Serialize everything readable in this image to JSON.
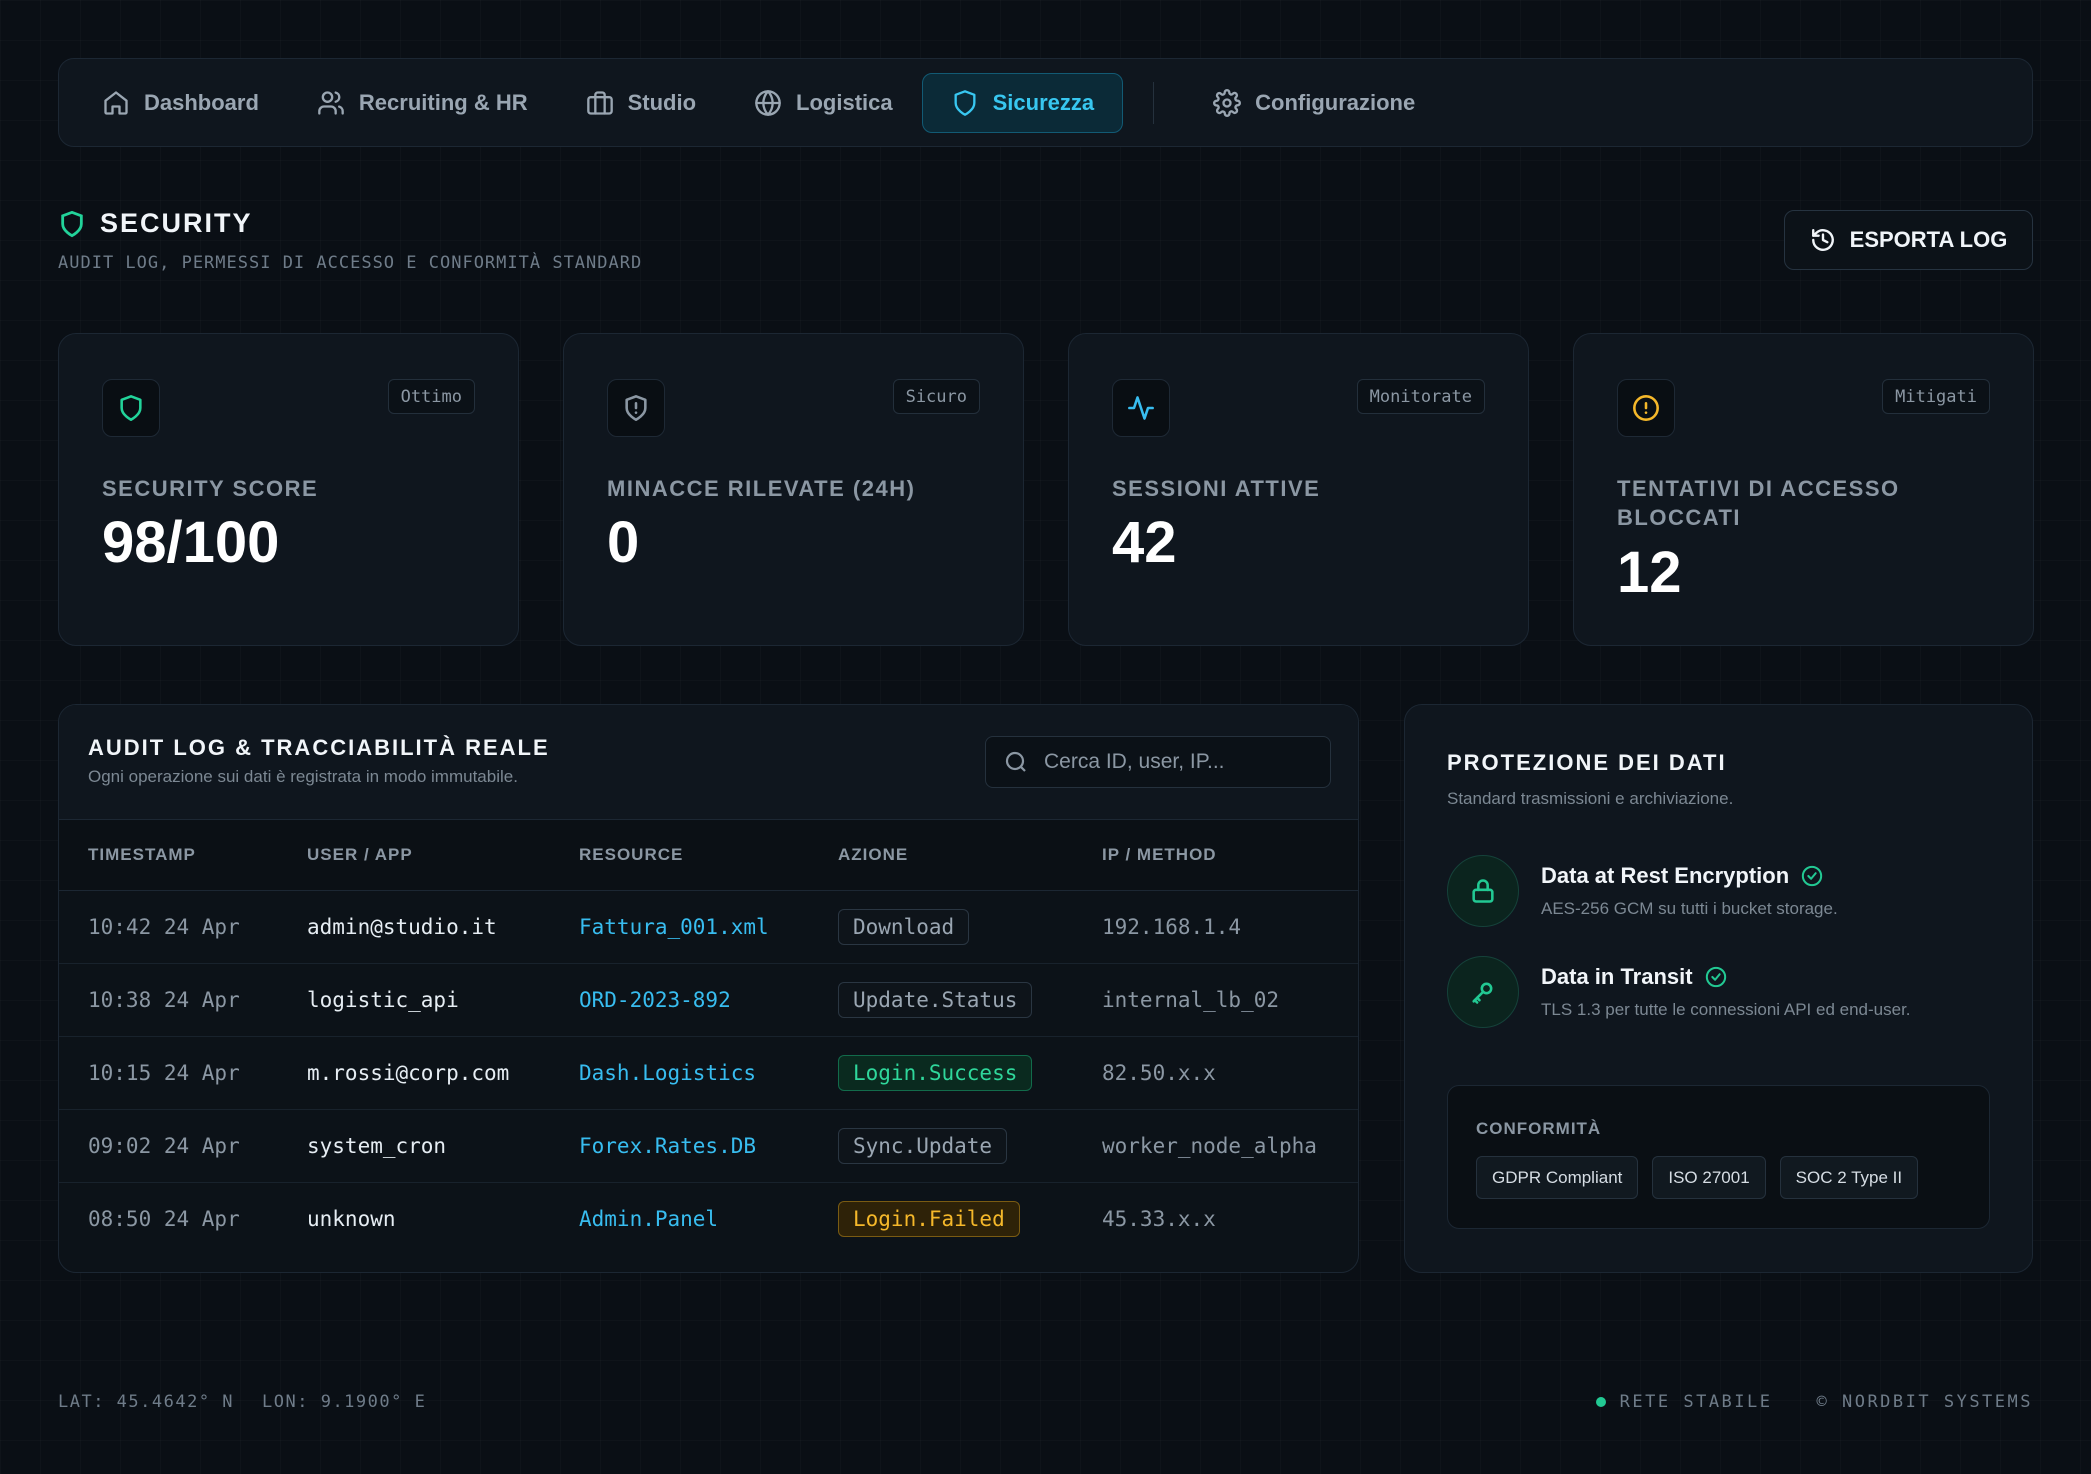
{
  "nav": {
    "items": [
      {
        "label": "Dashboard",
        "icon": "home-icon"
      },
      {
        "label": "Recruiting & HR",
        "icon": "users-icon"
      },
      {
        "label": "Studio",
        "icon": "briefcase-icon"
      },
      {
        "label": "Logistica",
        "icon": "globe-icon"
      },
      {
        "label": "Sicurezza",
        "icon": "shield-icon",
        "active": true
      },
      {
        "label": "Configurazione",
        "icon": "gear-icon"
      }
    ]
  },
  "header": {
    "title": "SECURITY",
    "subtitle": "AUDIT LOG, PERMESSI DI ACCESSO E CONFORMITÀ STANDARD",
    "export_label": "ESPORTA LOG"
  },
  "stats": [
    {
      "badge": "Ottimo",
      "label": "SECURITY SCORE",
      "value": "98/100",
      "icon": "shield-icon",
      "color": "#22d39a"
    },
    {
      "badge": "Sicuro",
      "label": "MINACCE RILEVATE (24H)",
      "value": "0",
      "icon": "shield-alert-icon",
      "color": "#8b97a3"
    },
    {
      "badge": "Monitorate",
      "label": "SESSIONI ATTIVE",
      "value": "42",
      "icon": "activity-icon",
      "color": "#38bdf0"
    },
    {
      "badge": "Mitigati",
      "label": "TENTATIVI DI ACCESSO BLOCCATI",
      "value": "12",
      "icon": "alert-circle-icon",
      "color": "#f5b82a"
    }
  ],
  "audit": {
    "title": "AUDIT LOG & TRACCIABILITÀ REALE",
    "subtitle": "Ogni operazione sui dati è registrata in modo immutabile.",
    "search_placeholder": "Cerca ID, user, IP...",
    "columns": [
      "TIMESTAMP",
      "USER / APP",
      "RESOURCE",
      "AZIONE",
      "IP / METHOD"
    ],
    "rows": [
      {
        "timestamp": "10:42 24 Apr",
        "user": "admin@studio.it",
        "resource": "Fattura_001.xml",
        "action": "Download",
        "action_type": "neutral",
        "ip": "192.168.1.4"
      },
      {
        "timestamp": "10:38 24 Apr",
        "user": "logistic_api",
        "resource": "ORD-2023-892",
        "action": "Update.Status",
        "action_type": "neutral",
        "ip": "internal_lb_02"
      },
      {
        "timestamp": "10:15 24 Apr",
        "user": "m.rossi@corp.com",
        "resource": "Dash.Logistics",
        "action": "Login.Success",
        "action_type": "success",
        "ip": "82.50.x.x"
      },
      {
        "timestamp": "09:02 24 Apr",
        "user": "system_cron",
        "resource": "Forex.Rates.DB",
        "action": "Sync.Update",
        "action_type": "neutral",
        "ip": "worker_node_alpha"
      },
      {
        "timestamp": "08:50 24 Apr",
        "user": "unknown",
        "resource": "Admin.Panel",
        "action": "Login.Failed",
        "action_type": "failed",
        "ip": "45.33.x.x"
      }
    ]
  },
  "protection": {
    "title": "PROTEZIONE DEI DATI",
    "subtitle": "Standard trasmissioni e archiviazione.",
    "items": [
      {
        "name": "Data at Rest Encryption",
        "desc": "AES-256 GCM su tutti i bucket storage.",
        "icon": "lock-icon"
      },
      {
        "name": "Data in Transit",
        "desc": "TLS 1.3 per tutte le connessioni API ed end-user.",
        "icon": "key-icon"
      }
    ],
    "compliance_title": "CONFORMITÀ",
    "compliance_tags": [
      "GDPR Compliant",
      "ISO 27001",
      "SOC 2 Type II"
    ]
  },
  "footer": {
    "lat": "LAT: 45.4642° N",
    "lon": "LON: 9.1900° E",
    "status": "RETE STABILE",
    "copyright": "© NORDBIT SYSTEMS"
  }
}
